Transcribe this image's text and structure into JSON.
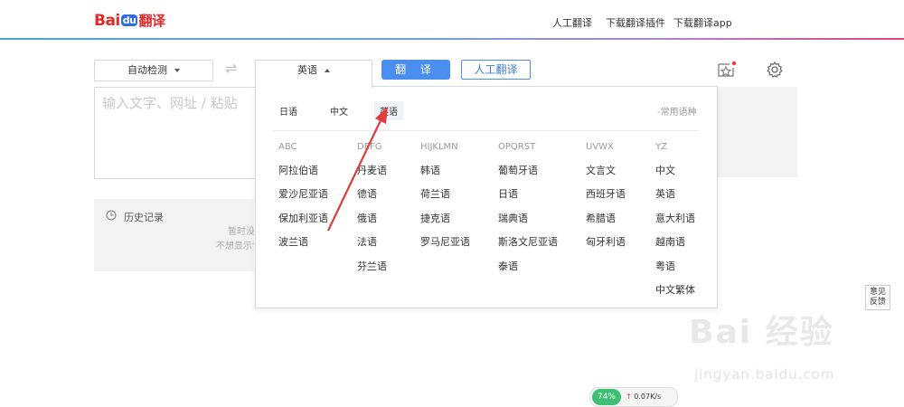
{
  "header": {
    "logo_bai": "Bai",
    "logo_du": "du",
    "logo_name": "翻译",
    "nav": [
      "人工翻译",
      "下载翻译插件",
      "下载翻译app"
    ]
  },
  "toolbar": {
    "source_lang": "自动检测",
    "target_lang": "英语",
    "translate_label": "翻 译",
    "human_translate_label": "人工翻译"
  },
  "input": {
    "placeholder": "输入文字、网址 / 粘贴"
  },
  "history": {
    "title": "历史记录",
    "empty_line1": "暂时没有",
    "empty_line2": "不想显示记录"
  },
  "dropdown": {
    "recent": [
      "日语",
      "中文",
      "英语"
    ],
    "recent_selected": "英语",
    "common_label": "-常用语种",
    "columns": [
      {
        "header": "ABC",
        "items": [
          "阿拉伯语",
          "爱沙尼亚语",
          "保加利亚语",
          "波兰语"
        ]
      },
      {
        "header": "DEFG",
        "items": [
          "丹麦语",
          "德语",
          "俄语",
          "法语",
          "芬兰语"
        ]
      },
      {
        "header": "HIJKLMN",
        "items": [
          "韩语",
          "荷兰语",
          "捷克语",
          "罗马尼亚语"
        ]
      },
      {
        "header": "OPQRST",
        "items": [
          "葡萄牙语",
          "日语",
          "瑞典语",
          "斯洛文尼亚语",
          "泰语"
        ]
      },
      {
        "header": "UVWX",
        "items": [
          "文言文",
          "西班牙语",
          "希腊语",
          "匈牙利语"
        ]
      },
      {
        "header": "YZ",
        "items": [
          "中文",
          "英语",
          "意大利语",
          "越南语",
          "粤语",
          "中文繁体"
        ]
      }
    ]
  },
  "feedback": {
    "line1": "意见",
    "line2": "反馈"
  },
  "watermark": {
    "main": "Bai 经验",
    "url": "jingyan.baidu.com"
  },
  "speed": {
    "percent": "74%",
    "rate": "0.07K/s"
  },
  "colors": {
    "accent": "#4a8ef0",
    "logo_red": "#e02a2a",
    "annotation": "#e03c3c"
  }
}
